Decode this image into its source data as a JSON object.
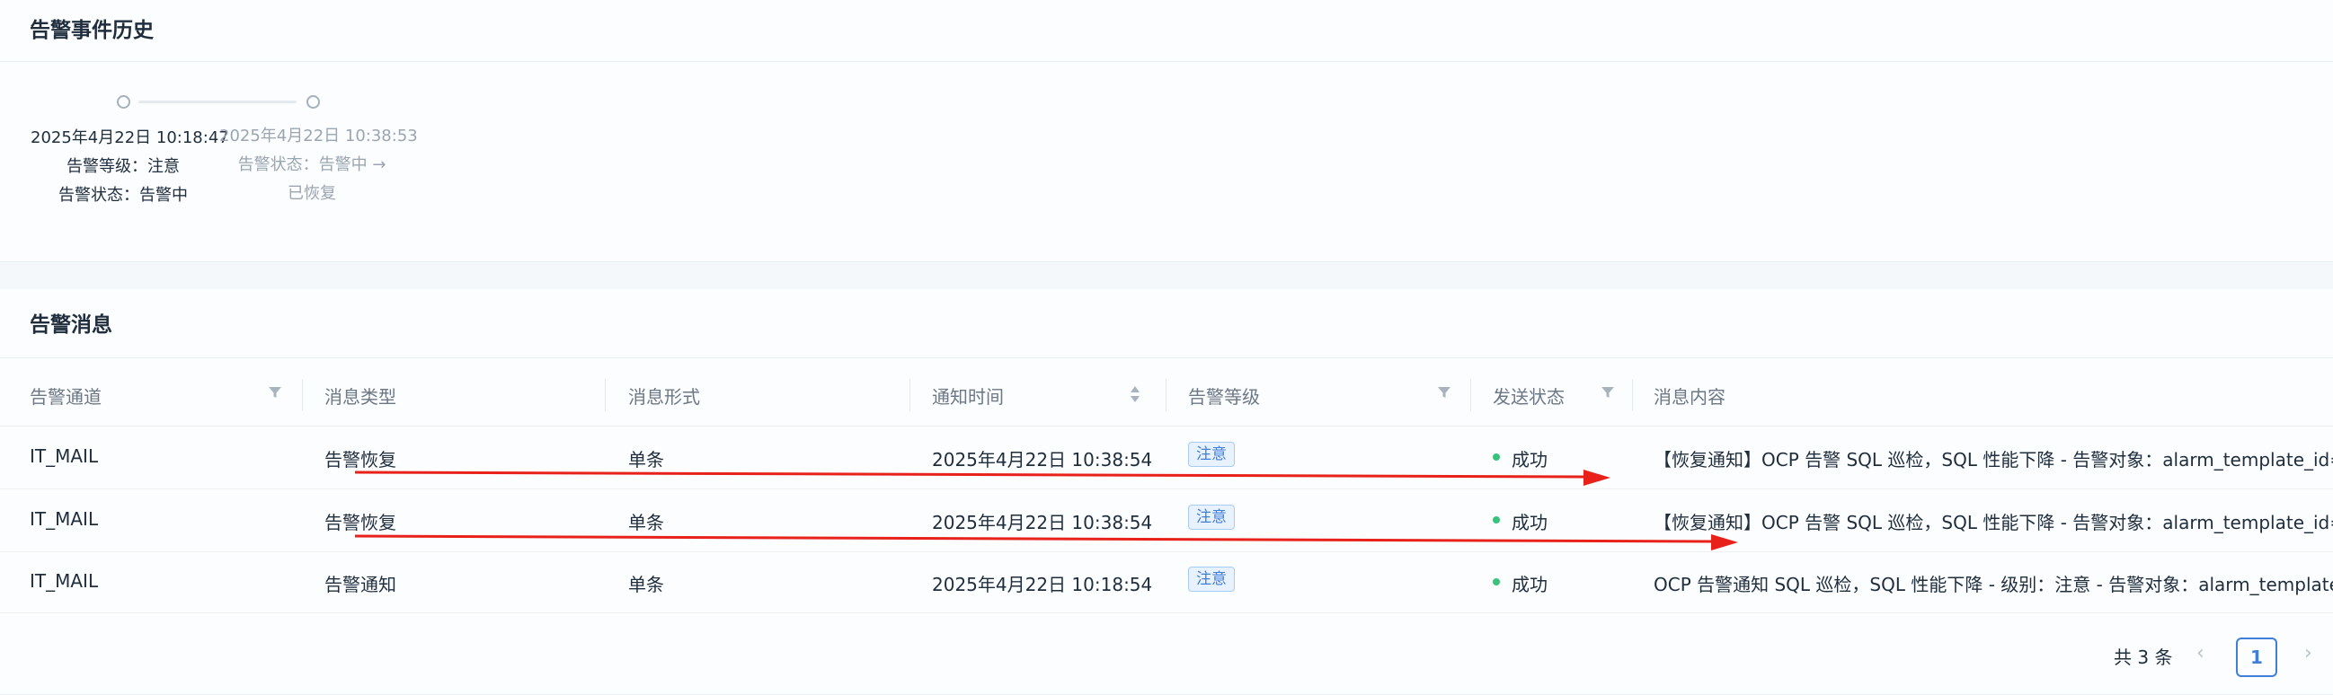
{
  "history": {
    "title": "告警事件历史",
    "events": [
      {
        "time": "2025年4月22日 10:18:47",
        "level_line": "告警等级：注意",
        "status_line": "告警状态：告警中"
      },
      {
        "time": "2025年4月22日 10:38:53",
        "status_line": "告警状态：告警中 →",
        "status_line_2": "已恢复"
      }
    ]
  },
  "messages": {
    "title": "告警消息",
    "columns": [
      "告警通道",
      "消息类型",
      "消息形式",
      "通知时间",
      "告警等级",
      "发送状态",
      "消息内容"
    ],
    "rows": [
      {
        "channel": "IT_MAIL",
        "type": "告警恢复",
        "form": "单条",
        "time": "2025年4月22日 10:38:54",
        "level": "注意",
        "status": "成功",
        "content": "【恢复通知】OCP 告警 SQL 巡检，SQL 性能下降 - 告警对象：alarm_template_id="
      },
      {
        "channel": "IT_MAIL",
        "type": "告警恢复",
        "form": "单条",
        "time": "2025年4月22日 10:38:54",
        "level": "注意",
        "status": "成功",
        "content": "【恢复通知】OCP 告警 SQL 巡检，SQL 性能下降 - 告警对象：alarm_template_id="
      },
      {
        "channel": "IT_MAIL",
        "type": "告警通知",
        "form": "单条",
        "time": "2025年4月22日 10:18:54",
        "level": "注意",
        "status": "成功",
        "content": "OCP 告警通知 SQL 巡检，SQL 性能下降 - 级别：注意 - 告警对象：alarm_template"
      }
    ],
    "pagination": {
      "total": "共 3 条",
      "prev": "‹",
      "current": "1",
      "next": "›"
    }
  },
  "colors": {
    "accent": "#3f7fd9",
    "success": "#36c37a",
    "annotation_arrow": "#e8221b"
  }
}
